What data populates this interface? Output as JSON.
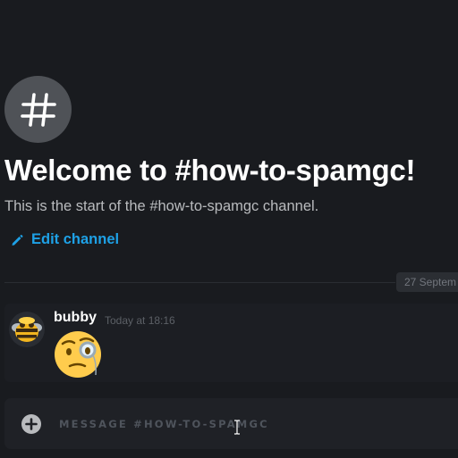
{
  "channel": {
    "icon": "hash-icon",
    "welcome_title": "Welcome to #how-to-spamgc!",
    "welcome_subtitle": "This is the start of the #how-to-spamgc channel.",
    "edit_label": "Edit channel"
  },
  "divider": {
    "date_label": "27 Septem"
  },
  "messages": [
    {
      "author": "bubby",
      "timestamp": "Today at 18:16",
      "avatar_icon": "bee-avatar",
      "content_icon": "face-with-monocle-emoji"
    }
  ],
  "composer": {
    "placeholder": "MESSAGE #HOW-TO-SPAMGC",
    "value": ""
  },
  "colors": {
    "background": "#191b1f",
    "link": "#1ea1e6",
    "message_bg": "#1c1e23",
    "composer_bg": "#1f2126"
  }
}
